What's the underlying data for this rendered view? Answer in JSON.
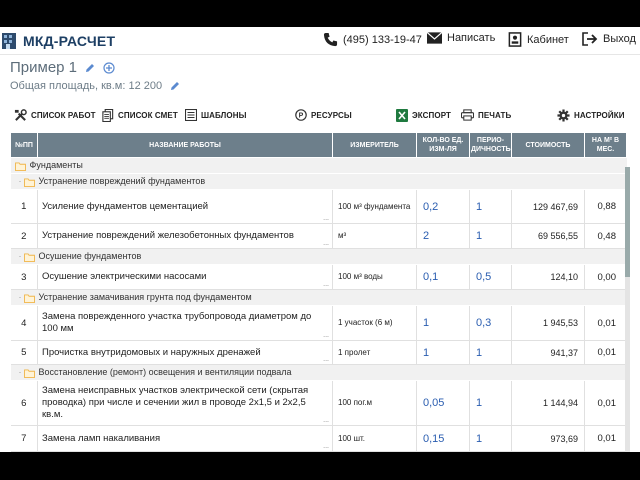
{
  "header": {
    "app_title": "МКД-РАСЧЕТ",
    "phone": "(495) 133-19-47",
    "write_label": "Написать",
    "cabinet_label": "Кабинет",
    "exit_label": "Выход"
  },
  "doc": {
    "title": "Пример 1",
    "area_label": "Общая площадь, кв.м: 12 200"
  },
  "toolbar": {
    "works_list": "СПИСОК РАБОТ",
    "estimates_list": "СПИСОК СМЕТ",
    "templates": "ШАБЛОНЫ",
    "resources": "РЕСУРСЫ",
    "export": "ЭКСПОРТ",
    "print": "ПЕЧАТЬ",
    "settings": "НАСТРОЙКИ"
  },
  "table": {
    "headers": {
      "num": "№ПП",
      "name": "НАЗВАНИЕ РАБОТЫ",
      "unit": "ИЗМЕРИТЕЛЬ",
      "qty": "КОЛ-ВО ЕД. ИЗМ-ЛЯ",
      "period": "ПЕРИО-ДИЧНОСТЬ",
      "cost": "СТОИМОСТЬ",
      "per_month": "НА М² В МЕС."
    },
    "groups": {
      "g0": "Фундаменты",
      "g1": "Устранение повреждений фундаментов",
      "g2": "Осушение фундаментов",
      "g3": "Устранение замачивания грунта под фундаментом",
      "g4": "Восстановление (ремонт) освещения и вентиляции подвала"
    },
    "rows": [
      {
        "num": "1",
        "name": "Усиление фундаментов цементацией",
        "unit": "100 м³ фундамента",
        "qty": "0,2",
        "period": "1",
        "cost": "129 467,69",
        "per_month": "0,88"
      },
      {
        "num": "2",
        "name": "Устранение повреждений железобетонных фундаментов",
        "unit": "м³",
        "qty": "2",
        "period": "1",
        "cost": "69 556,55",
        "per_month": "0,48"
      },
      {
        "num": "3",
        "name": "Осушение электрическими насосами",
        "unit": "100 м³ воды",
        "qty": "0,1",
        "period": "0,5",
        "cost": "124,10",
        "per_month": "0,00"
      },
      {
        "num": "4",
        "name": "Замена поврежденного участка трубопровода диаметром до 100 мм",
        "unit": "1 участок (6 м)",
        "qty": "1",
        "period": "0,3",
        "cost": "1 945,53",
        "per_month": "0,01"
      },
      {
        "num": "5",
        "name": "Прочистка внутридомовых и наружных дренажей",
        "unit": "1 пролет",
        "qty": "1",
        "period": "1",
        "cost": "941,37",
        "per_month": "0,01"
      },
      {
        "num": "6",
        "name": "Замена неисправных участков электрической сети (скрытая проводка) при числе и сечении жил в проводе 2х1,5 и 2х2,5 кв.м.",
        "unit": "100 пог.м",
        "qty": "0,05",
        "period": "1",
        "cost": "1 144,94",
        "per_month": "0,01"
      },
      {
        "num": "7",
        "name": "Замена ламп накаливания",
        "unit": "100 шт.",
        "qty": "0,15",
        "period": "1",
        "cost": "973,69",
        "per_month": "0,01"
      }
    ],
    "ellipsis": "..."
  },
  "colors": {
    "brand": "#1d3f64",
    "header_bg": "#6d7f8b",
    "link_blue": "#2a5db0",
    "folder": "#f0b548"
  }
}
